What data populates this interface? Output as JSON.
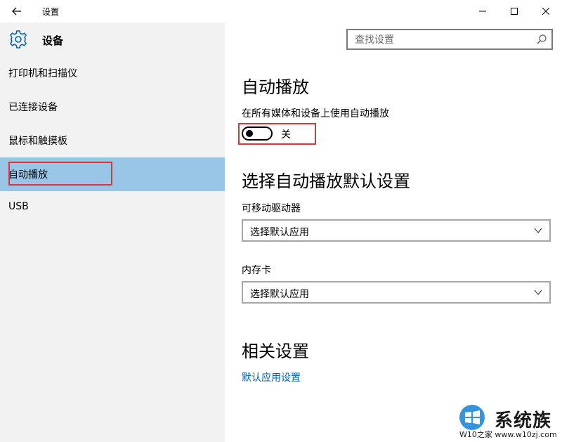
{
  "window": {
    "title": "设置"
  },
  "header": {
    "title": "设备"
  },
  "search": {
    "placeholder": "查找设置"
  },
  "sidebar": {
    "items": [
      {
        "label": "打印机和扫描仪"
      },
      {
        "label": "已连接设备"
      },
      {
        "label": "鼠标和触摸板"
      },
      {
        "label": "自动播放",
        "selected": true
      },
      {
        "label": "USB"
      }
    ]
  },
  "main": {
    "autoplay_title": "自动播放",
    "autoplay_desc": "在所有媒体和设备上使用自动播放",
    "toggle_state": "关",
    "defaults_title": "选择自动播放默认设置",
    "removable_label": "可移动驱动器",
    "removable_value": "选择默认应用",
    "memcard_label": "内存卡",
    "memcard_value": "选择默认应用",
    "related_title": "相关设置",
    "related_link": "默认应用设置"
  },
  "watermark": {
    "brand": "系统族",
    "url": "W10之家 www.w10zj.com"
  },
  "colors": {
    "selected_nav": "#99c5e6",
    "highlight_box": "#d9363e",
    "link": "#0063b1",
    "sidebar_bg": "#f2f2f2"
  }
}
